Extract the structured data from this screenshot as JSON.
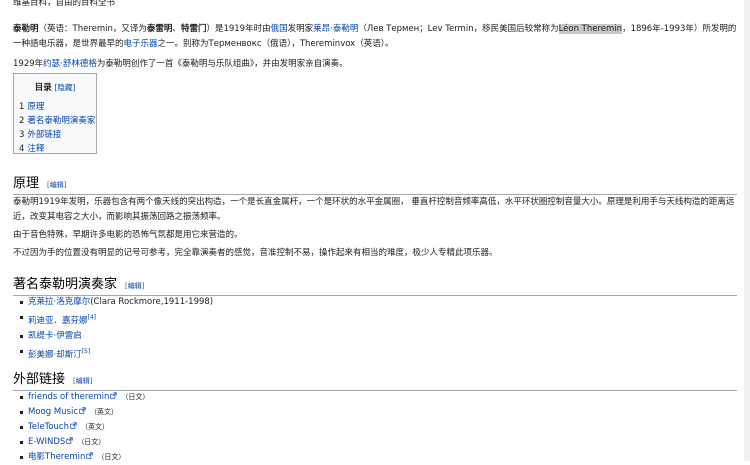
{
  "site_subtitle": "维基百科，自由的百科全书",
  "intro": {
    "title_bold": "泰勒明",
    "part1": "（英语：Theremin，又译为",
    "alias1": "泰雷明",
    "sep": "、",
    "alias2": "特雷门",
    "part2": "）是1919年时由",
    "link_russia": "俄国",
    "part3": "发明家",
    "link_inventor": "莱昂·泰勒明",
    "part4": "（Лев Термен；Lev Termin，移民美国后较常称为",
    "highlight": "Léon Theremin",
    "part5": "，1896年-1993年）所发明的一种語电乐器，是世界最早的",
    "link_electronic": "电子乐器",
    "part6": "之一。别称为Терменвокс（俄语），Thereminvox（英语）。"
  },
  "para2": {
    "year": "1929年",
    "link_person": "约瑟·舒林德格",
    "rest": "为泰勒明创作了一首《泰勒明与乐队组曲》，并由发明家亲自演奏。"
  },
  "toc": {
    "title": "目录",
    "toggle": "[隐藏]",
    "items": [
      {
        "num": "1",
        "label": "原理"
      },
      {
        "num": "2",
        "label": "著名泰勒明演奏家"
      },
      {
        "num": "3",
        "label": "外部链接"
      },
      {
        "num": "4",
        "label": "注释"
      }
    ]
  },
  "sec_principle": {
    "heading": "原理",
    "edit_open": "[",
    "edit_label": "编辑",
    "edit_close": "]",
    "p1": "泰勒明1919年发明，乐器包含有两个像天线的突出构造，一个是长直金属杆，一个是环状的水平金属圈，  垂直杆控制音频率高低，水平环状圈控制音量大小。原理是利用手与天线构造的距离远近，改变其电容之大小，而影响其振荡回路之振荡频率。",
    "p2": "由于音色特殊，早期许多电影的恐怖气氛都是用它来营造的。",
    "p3": "不过因为手的位置没有明显的记号可参考，完全靠演奏者的感觉，音准控制不易，操作起来有相当的难度，极少人专精此项乐器。"
  },
  "sec_players": {
    "heading": "著名泰勒明演奏家",
    "edit_open": "[",
    "edit_label": "编辑",
    "edit_close": "]",
    "items": [
      {
        "name": "克莱拉·洛克摩尔",
        "extra": "(Clara Rockmore,1911-1998)",
        "ref": ""
      },
      {
        "name": "莉迪亚．嘉芬娜",
        "extra": "",
        "ref": "[4]"
      },
      {
        "name": "凯缇卡·伊雷启",
        "extra": "",
        "ref": ""
      },
      {
        "name": "彭美娜·却斯汀",
        "extra": "",
        "ref": "[5]"
      }
    ]
  },
  "sec_links": {
    "heading": "外部链接",
    "edit_open": "[",
    "edit_label": "编辑",
    "edit_close": "]",
    "items": [
      {
        "label": "friends of theremin",
        "lang": "（日文）"
      },
      {
        "label": "Moog Music",
        "lang": "（英文）"
      },
      {
        "label": "TeleTouch",
        "lang": "（英文）"
      },
      {
        "label": "E-WINDS",
        "lang": "（日文）"
      },
      {
        "label": "电影Theremin",
        "lang": "（日文）"
      }
    ]
  },
  "colors": {
    "link": "#0645ad",
    "text": "#202122",
    "highlight": "#c8c8c8"
  }
}
